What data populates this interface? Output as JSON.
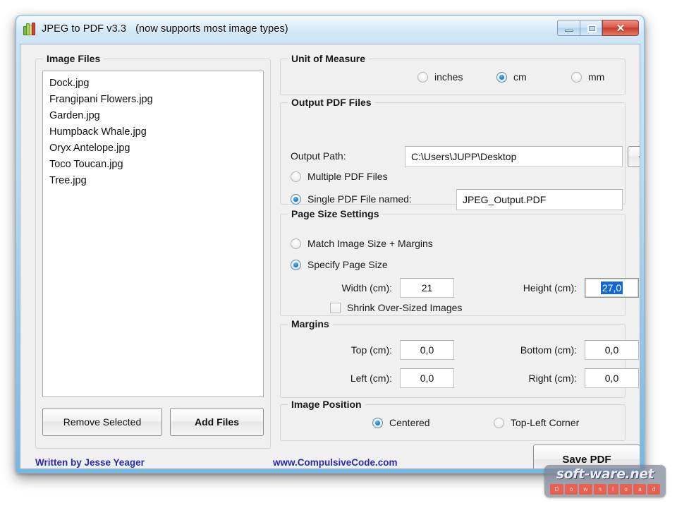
{
  "window": {
    "title": "JPEG to PDF  v3.3",
    "subtitle": "(now supports most image types)",
    "icon": "app-bars-icon",
    "minimize_label": "–",
    "maximize_label": "□",
    "close_label": "✕"
  },
  "image_files": {
    "legend": "Image Files",
    "items": [
      "Dock.jpg",
      "Frangipani Flowers.jpg",
      "Garden.jpg",
      "Humpback Whale.jpg",
      "Oryx Antelope.jpg",
      "Toco Toucan.jpg",
      "Tree.jpg"
    ],
    "remove_label": "Remove Selected",
    "add_label": "Add Files"
  },
  "unit_of_measure": {
    "legend": "Unit of Measure",
    "options": [
      "inches",
      "cm",
      "mm"
    ],
    "selected": "cm"
  },
  "output": {
    "legend": "Output PDF Files",
    "path_label": "Output Path:",
    "path_value": "C:\\Users\\JUPP\\Desktop",
    "browse_label": "...",
    "multiple_label": "Multiple PDF Files",
    "single_label": "Single PDF File named:",
    "single_filename": "JPEG_Output.PDF",
    "selected": "single"
  },
  "page_size": {
    "legend": "Page Size Settings",
    "match_label": "Match Image Size + Margins",
    "specify_label": "Specify Page Size",
    "selected": "specify",
    "width_label": "Width (cm):",
    "width_value": "21",
    "height_label": "Height (cm):",
    "height_value": "27,0",
    "shrink_label": "Shrink Over-Sized Images",
    "shrink_checked": false
  },
  "margins": {
    "legend": "Margins",
    "top_label": "Top (cm):",
    "top_value": "0,0",
    "bottom_label": "Bottom (cm):",
    "bottom_value": "0,0",
    "left_label": "Left (cm):",
    "left_value": "0,0",
    "right_label": "Right (cm):",
    "right_value": "0,0"
  },
  "image_position": {
    "legend": "Image Position",
    "options": [
      "Centered",
      "Top-Left Corner"
    ],
    "selected": "Centered"
  },
  "footer": {
    "author": "Written by Jesse Yeager",
    "website": "www.CompulsiveCode.com",
    "save_label": "Save PDF"
  },
  "watermark": {
    "title": "soft-ware.net",
    "letters": [
      "D",
      "o",
      "w",
      "n",
      "l",
      "o",
      "a",
      "d"
    ]
  },
  "colors": {
    "accent_blue": "#1b7fc4",
    "link_blue": "#2a2ab4",
    "selection_blue": "#1367d6",
    "close_red": "#c33f2d",
    "watermark_red": "#e8604f"
  }
}
